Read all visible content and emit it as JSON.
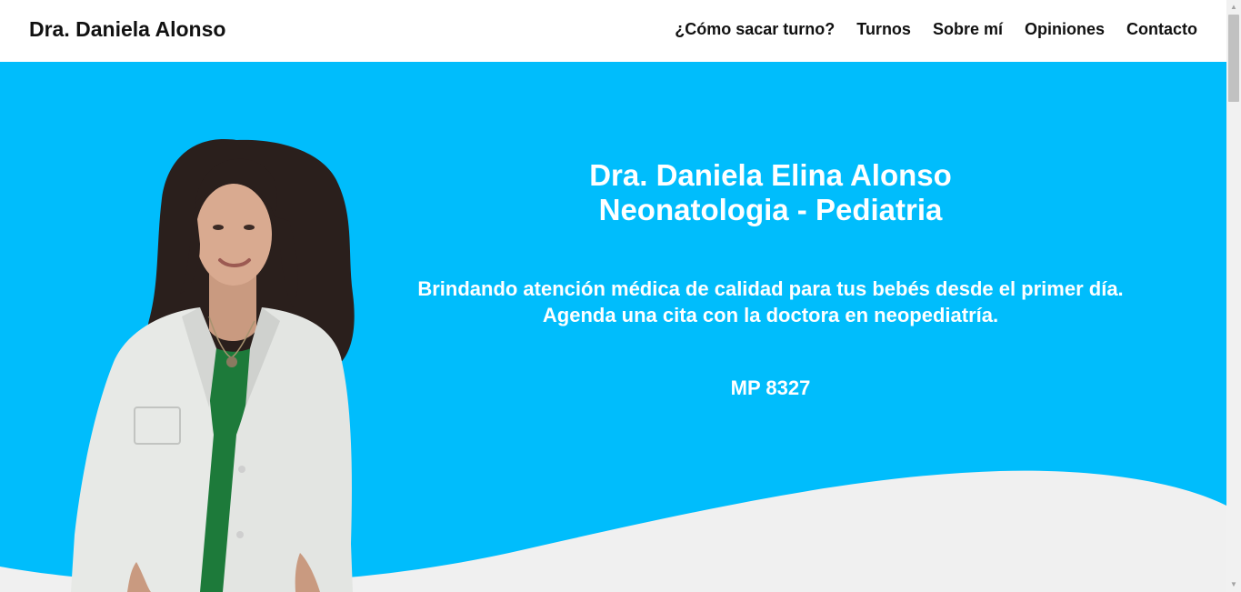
{
  "header": {
    "brand": "Dra. Daniela Alonso",
    "nav": [
      {
        "label": "¿Cómo sacar turno?"
      },
      {
        "label": "Turnos"
      },
      {
        "label": "Sobre mí"
      },
      {
        "label": "Opiniones"
      },
      {
        "label": "Contacto"
      }
    ]
  },
  "hero": {
    "title_line1": "Dra. Daniela Elina Alonso",
    "title_line2": "Neonatologia - Pediatria",
    "subtitle_line1": "Brindando atención médica de calidad para tus bebés desde el primer día.",
    "subtitle_line2": "Agenda una cita con la doctora en neopediatría.",
    "license": "MP 8327"
  },
  "colors": {
    "hero_background": "#00bdfc",
    "wave": "#f0f0f0",
    "header_background": "#ffffff",
    "text_dark": "#111111",
    "text_light": "#ffffff"
  },
  "icons": {
    "scroll_up": "triangle-up-icon",
    "scroll_down": "triangle-down-icon"
  }
}
